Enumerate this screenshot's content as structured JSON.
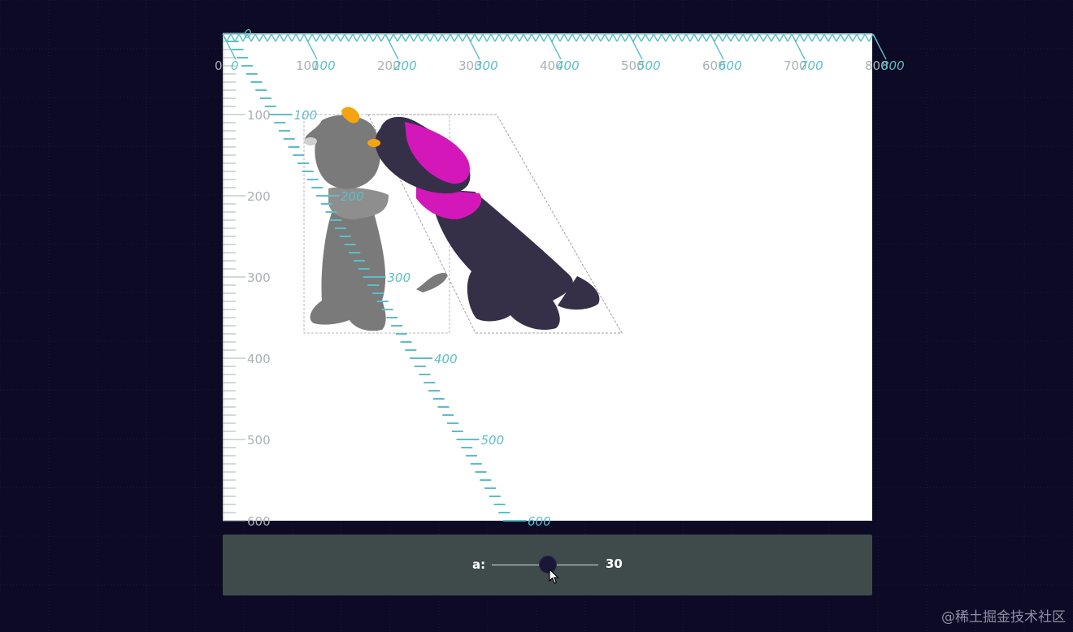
{
  "canvas": {
    "x_ticks": [
      "0",
      "100",
      "200",
      "300",
      "400",
      "500",
      "600",
      "700",
      "800"
    ],
    "y_ticks": [
      "100",
      "200",
      "300",
      "400",
      "500",
      "600"
    ],
    "skewed_x_ticks": [
      "0",
      "100",
      "200",
      "300",
      "400",
      "500",
      "600",
      "700",
      "800"
    ],
    "skewed_y_ticks": [
      "0",
      "100",
      "200",
      "300",
      "400",
      "500",
      "600"
    ],
    "colors": {
      "page_bg": "#0c0a24",
      "canvas_bg": "#ffffff",
      "ruler_gray": "#a8b1b3",
      "ruler_teal": "#5bbfc7",
      "dog_gray": "#7a7a7a",
      "dog_dark": "#353048",
      "hat_magenta": "#d417b9",
      "ear_orange": "#f5a311"
    }
  },
  "controls": {
    "slider_label": "a:",
    "slider_value": "30",
    "slider_level_fraction": 0.53
  },
  "watermark": "@稀土掘金技术社区"
}
